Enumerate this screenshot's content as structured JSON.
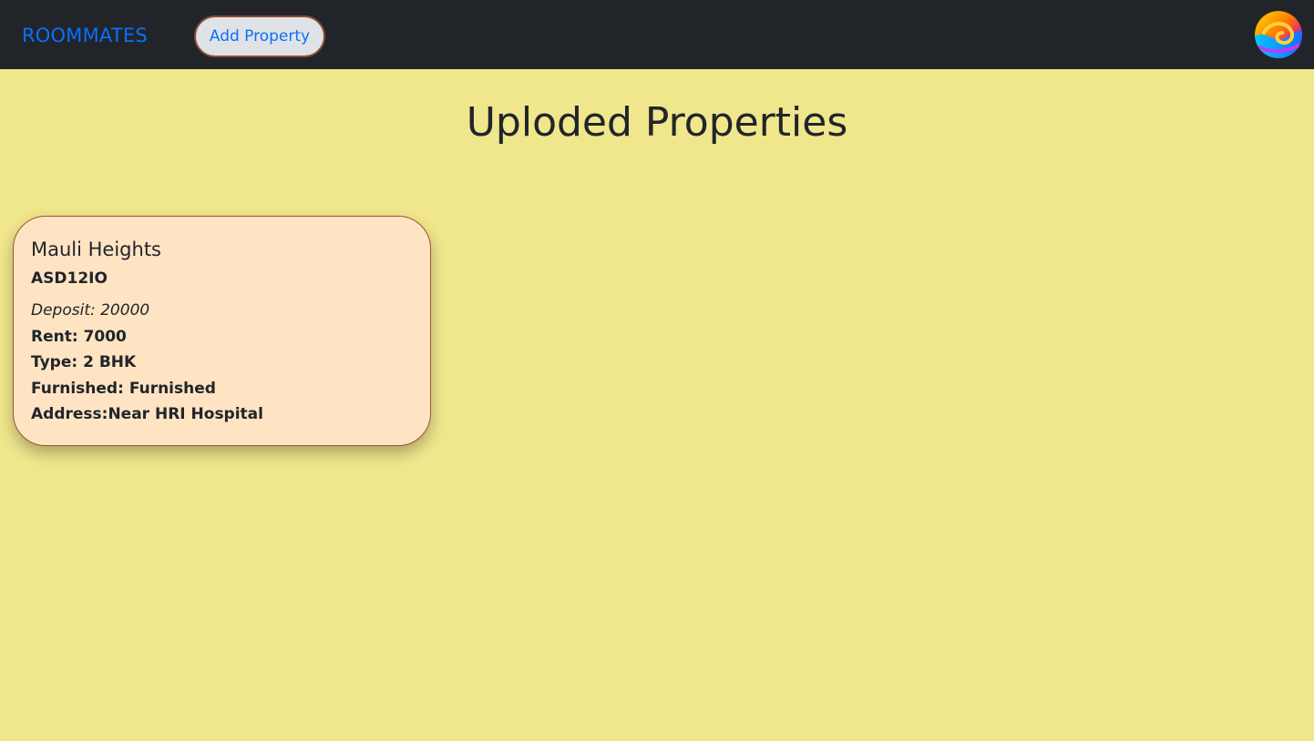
{
  "nav": {
    "brand": "ROOMMATES",
    "add_property_label": "Add Property",
    "avatar_icon": "gradient-swirl-avatar-icon"
  },
  "main": {
    "title": "Uploded Properties",
    "properties": [
      {
        "name": "Mauli Heights",
        "code": "ASD12IO",
        "deposit": "Deposit: 20000",
        "rent": "Rent: 7000",
        "type": "Type: 2 BHK",
        "furnished": "Furnished: Furnished",
        "address": "Address:Near HRI Hospital"
      }
    ]
  },
  "colors": {
    "background": "#f0e68c",
    "navbar": "#212529",
    "link": "#0d6efd",
    "card_background": "#ffe4c4",
    "card_border": "#a0522d"
  }
}
